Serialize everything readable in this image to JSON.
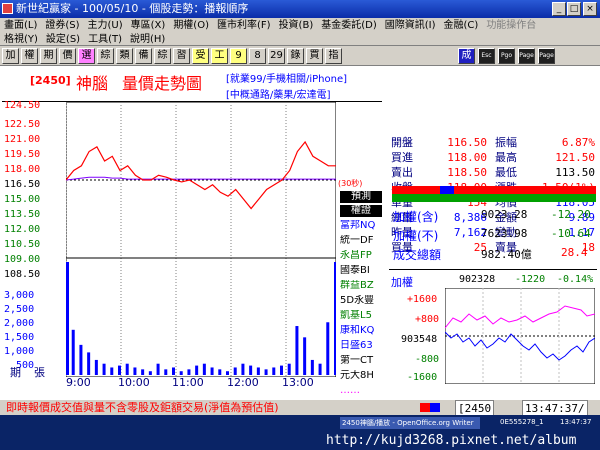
{
  "window": {
    "title": "新世紀贏家 - 100/05/10 - 個股走勢：播報順序",
    "right_menu": "功能操作台"
  },
  "menu": {
    "row1": [
      "畫面(L)",
      "證券(S)",
      "主力(U)",
      "專區(X)",
      "期權(O)",
      "匯市利率(F)",
      "投資(B)",
      "基金委託(D)",
      "國際資訊(I)",
      "金融(C)",
      "功能(H)"
    ],
    "row2": [
      "格視(Y)",
      "設定(S)",
      "工具(T)",
      "說明(H)"
    ]
  },
  "toolbar": {
    "buttons": [
      "加",
      "權",
      "期",
      "價",
      "選",
      "綜",
      "類",
      "備",
      "綜",
      "習",
      "受",
      "工",
      "9",
      "8",
      "29",
      "錄",
      "買",
      "指",
      "成",
      "Esc",
      "Pgo",
      "Page Up",
      "Page Down"
    ]
  },
  "stock": {
    "code": "2450",
    "name": "神腦",
    "chart_title": "量價走勢圖",
    "tags1": "就業99/手機相關/iPhone",
    "tags2": "中概通路/藥果/宏達電",
    "ref_label": "(30秒)"
  },
  "quote": {
    "rows": [
      {
        "l1": "開盤",
        "v1": "116.50",
        "c1": "red",
        "l2": "振幅",
        "v2": "6.87%",
        "c2": "red"
      },
      {
        "l1": "買進",
        "v1": "118.00",
        "c1": "red",
        "l2": "最高",
        "v2": "121.50",
        "c2": "red"
      },
      {
        "l1": "賣出",
        "v1": "118.50",
        "c1": "red",
        "l2": "最低",
        "v2": "113.50",
        "c2": "black"
      },
      {
        "l1": "收盤",
        "v1": "118.00",
        "c1": "red",
        "l2": "漲跌",
        "v2": "1.50(1%)",
        "c2": "red"
      },
      {
        "l1": "單量",
        "v1": "154",
        "c1": "red",
        "l2": "均價",
        "v2": "118.05",
        "c2": "blue"
      },
      {
        "l1": "總量",
        "v1": "8,386",
        "c1": "blue",
        "l2": "金額",
        "v2": "9.89",
        "c2": "blue"
      },
      {
        "l1": "昨量",
        "v1": "7,162",
        "c1": "blue",
        "l2": "變動",
        "v2": "1.17",
        "c2": "blue"
      },
      {
        "l1": "買量",
        "v1": "25",
        "c1": "red",
        "l2": "賣量",
        "v2": "18",
        "c2": "red"
      }
    ]
  },
  "index": {
    "rows": [
      {
        "label": "加權(含)",
        "value": "9023.28",
        "change": "-12.20"
      },
      {
        "label": "加權(不)",
        "value": "7623.98",
        "change": "-10.64"
      },
      {
        "label": "成交總額",
        "value": "982.40億",
        "change": "28.4"
      }
    ],
    "mini_label": "加權",
    "mini_value": "902328",
    "mini_change": "-1220",
    "mini_pct": "-0.14%",
    "mini_axis": [
      "+1600",
      "+800",
      "903548",
      "-800",
      "-1600"
    ]
  },
  "symbols": {
    "header1": "預測",
    "header2": "權證",
    "items": [
      {
        "text": "富邦NQ",
        "color": "#0000ff"
      },
      {
        "text": "統一DF",
        "color": "#000000"
      },
      {
        "text": "永昌FP",
        "color": "#008000"
      },
      {
        "text": "國泰BI",
        "color": "#000000"
      },
      {
        "text": "群益BZ",
        "color": "#008000"
      },
      {
        "text": "5D永豐",
        "color": "#000000"
      },
      {
        "text": "凱基L5",
        "color": "#008000"
      },
      {
        "text": "康和KQ",
        "color": "#0000ff"
      },
      {
        "text": "日盛63",
        "color": "#0000ff"
      },
      {
        "text": "第一CT",
        "color": "#000000"
      },
      {
        "text": "元大8H",
        "color": "#000000"
      },
      {
        "text": "……",
        "color": "#ff00ff"
      }
    ]
  },
  "chart_data": {
    "type": "line",
    "x_labels": [
      "9:00",
      "10:00",
      "11:00",
      "12:00",
      "13:00"
    ],
    "price_axis": [
      "124.50",
      "122.50",
      "121.00",
      "119.50",
      "118.00",
      "116.50",
      "115.00",
      "113.50",
      "112.00",
      "110.50",
      "109.00",
      "108.50"
    ],
    "volume_axis": [
      "3,000",
      "2,500",
      "2,000",
      "1,500",
      "1,000",
      "500"
    ],
    "reference_price": 116.5,
    "price_series": [
      116.5,
      117.5,
      118,
      119.5,
      120,
      118.5,
      119,
      117.5,
      118,
      117,
      116.5,
      116.5,
      117,
      116.8,
      116.5,
      116.3,
      116.5,
      116,
      115.5,
      116,
      115.2,
      114.8,
      115.5,
      114.5,
      113.5,
      114.5,
      115.5,
      116,
      116.5,
      117.5,
      119.5,
      120.5,
      119,
      118.5,
      118,
      118
    ],
    "avg_series": [
      116.5,
      116.6,
      116.7,
      116.8,
      116.8,
      116.8,
      116.7,
      116.7,
      116.6,
      116.6,
      116.6,
      116.6,
      116.6,
      116.6,
      116.6,
      116.6,
      116.6,
      116.6,
      116.6,
      116.6,
      116.6,
      116.6,
      116.6,
      116.6,
      116.6,
      116.6,
      116.6,
      116.6,
      116.6,
      116.6,
      116.6,
      116.6,
      116.6,
      116.6,
      116.6,
      116.6
    ],
    "volume_values": [
      3000,
      1200,
      800,
      600,
      400,
      300,
      200,
      250,
      300,
      200,
      150,
      100,
      300,
      150,
      200,
      100,
      150,
      250,
      300,
      200,
      150,
      100,
      200,
      300,
      250,
      200,
      150,
      200,
      250,
      300,
      1300,
      1000,
      400,
      300,
      1400,
      3000
    ],
    "bottom_labels": [
      "期",
      "張"
    ],
    "ylim": [
      108.5,
      124.5
    ]
  },
  "statusbar": {
    "text": "即時報價成交值與量不含零股及鉅額交易(淨值為預估值)",
    "code": "2450",
    "time": "13:47:37/"
  },
  "taskbar": {
    "item": "2450神腦/播放 - OpenOffice.org Writer",
    "right": "0E555278_1",
    "clock": "13:47:37",
    "url": "http://kujd3268.pixnet.net/album"
  }
}
